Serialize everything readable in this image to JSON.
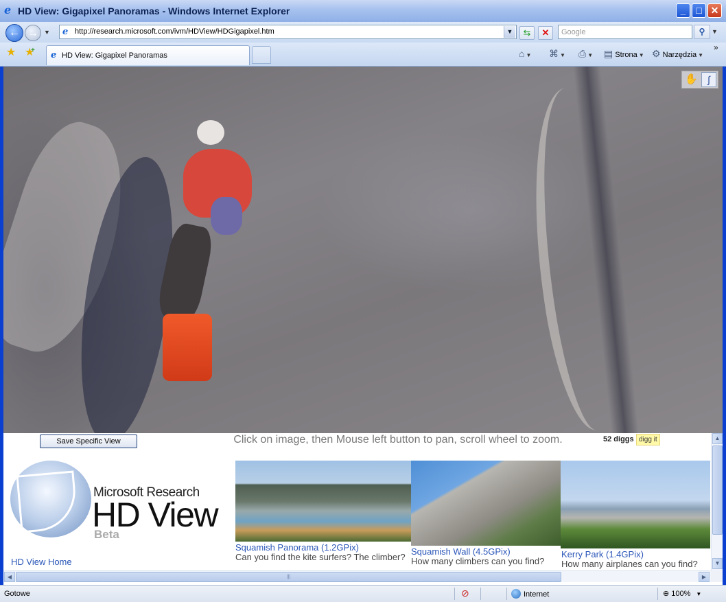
{
  "window": {
    "title": "HD View: Gigapixel Panoramas - Windows Internet Explorer",
    "min_glyph": "_",
    "max_glyph": "□",
    "close_glyph": "✕"
  },
  "nav": {
    "url": "http://research.microsoft.com/ivm/HDView/HDGigapixel.htm",
    "search_placeholder": "Google"
  },
  "tabs": [
    {
      "label": "HD View: Gigapixel Panoramas",
      "active": true
    }
  ],
  "command_bar": {
    "page_label": "Strona",
    "tools_label": "Narzędzia"
  },
  "viewer": {
    "save_button": "Save Specific View",
    "instructions": "Click on image, then Mouse left button to pan, scroll wheel to zoom.",
    "diggs": "52 diggs",
    "digg_it": "digg it"
  },
  "logo": {
    "company": "Microsoft Research",
    "product": "HD View",
    "badge": "Beta"
  },
  "home_link": "HD View Home",
  "panoramas": [
    {
      "title": "Squamish Panorama (1.2GPix)",
      "description": "Can you find the kite surfers? The climber?"
    },
    {
      "title": "Squamish Wall (4.5GPix)",
      "description": "How many climbers can you find?"
    },
    {
      "title": "Kerry Park (1.4GPix)",
      "description": "How many airplanes can you find?"
    }
  ],
  "status": {
    "text": "Gotowe",
    "zone": "Internet",
    "zoom": "100%"
  },
  "colors": {
    "link": "#2a56b8",
    "titlebar": "#a6c1ee",
    "haul_bag": "#f05a2a"
  }
}
